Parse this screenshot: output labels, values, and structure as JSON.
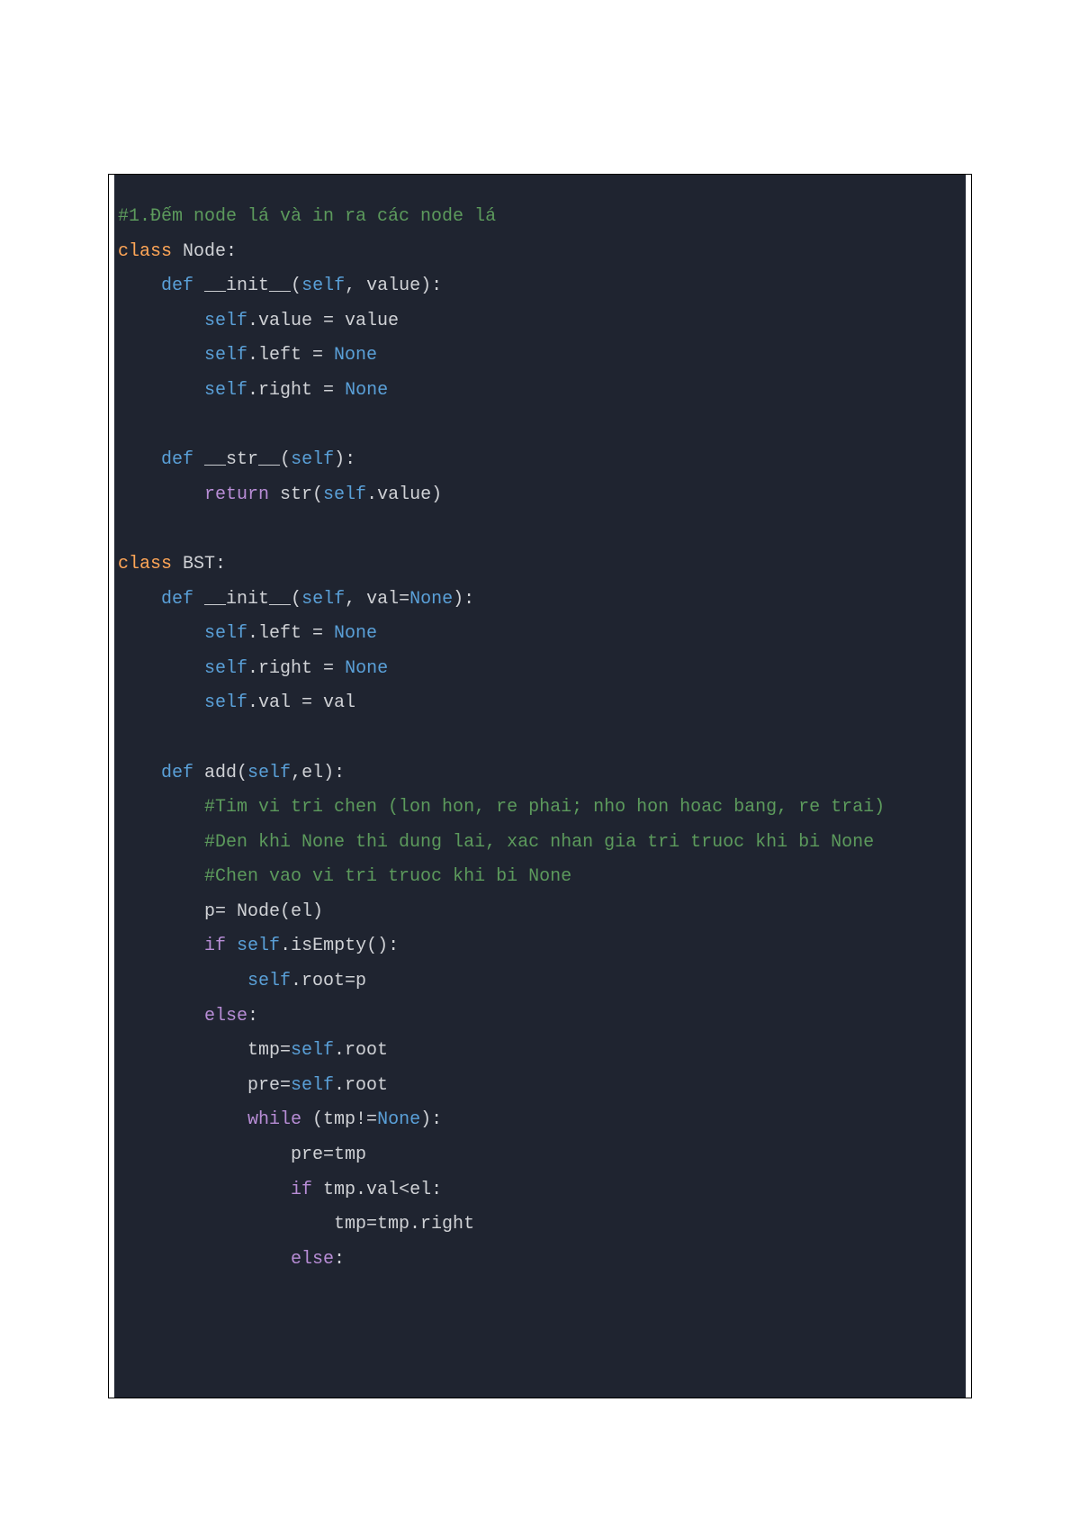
{
  "code": {
    "lines": [
      [
        {
          "t": "#1.Đếm node lá và in ra các node lá",
          "c": "c-comment"
        }
      ],
      [
        {
          "t": "class",
          "c": "c-keyword"
        },
        {
          "t": " Node:",
          "c": "c-name"
        }
      ],
      [
        {
          "t": "    ",
          "c": "c-name"
        },
        {
          "t": "def",
          "c": "c-def"
        },
        {
          "t": " __init__(",
          "c": "c-name"
        },
        {
          "t": "self",
          "c": "c-self"
        },
        {
          "t": ", value):",
          "c": "c-name"
        }
      ],
      [
        {
          "t": "        ",
          "c": "c-name"
        },
        {
          "t": "self",
          "c": "c-self"
        },
        {
          "t": ".value = value",
          "c": "c-name"
        }
      ],
      [
        {
          "t": "        ",
          "c": "c-name"
        },
        {
          "t": "self",
          "c": "c-self"
        },
        {
          "t": ".left = ",
          "c": "c-name"
        },
        {
          "t": "None",
          "c": "c-none"
        }
      ],
      [
        {
          "t": "        ",
          "c": "c-name"
        },
        {
          "t": "self",
          "c": "c-self"
        },
        {
          "t": ".right = ",
          "c": "c-name"
        },
        {
          "t": "None",
          "c": "c-none"
        }
      ],
      [
        {
          "t": "",
          "c": "c-name"
        }
      ],
      [
        {
          "t": "    ",
          "c": "c-name"
        },
        {
          "t": "def",
          "c": "c-def"
        },
        {
          "t": " __str__(",
          "c": "c-name"
        },
        {
          "t": "self",
          "c": "c-self"
        },
        {
          "t": "):",
          "c": "c-name"
        }
      ],
      [
        {
          "t": "        ",
          "c": "c-name"
        },
        {
          "t": "return",
          "c": "c-return"
        },
        {
          "t": " str(",
          "c": "c-name"
        },
        {
          "t": "self",
          "c": "c-self"
        },
        {
          "t": ".value)",
          "c": "c-name"
        }
      ],
      [
        {
          "t": "",
          "c": "c-name"
        }
      ],
      [
        {
          "t": "class",
          "c": "c-keyword"
        },
        {
          "t": " BST:",
          "c": "c-name"
        }
      ],
      [
        {
          "t": "    ",
          "c": "c-name"
        },
        {
          "t": "def",
          "c": "c-def"
        },
        {
          "t": " __init__(",
          "c": "c-name"
        },
        {
          "t": "self",
          "c": "c-self"
        },
        {
          "t": ", val=",
          "c": "c-name"
        },
        {
          "t": "None",
          "c": "c-none"
        },
        {
          "t": "):",
          "c": "c-name"
        }
      ],
      [
        {
          "t": "        ",
          "c": "c-name"
        },
        {
          "t": "self",
          "c": "c-self"
        },
        {
          "t": ".left = ",
          "c": "c-name"
        },
        {
          "t": "None",
          "c": "c-none"
        }
      ],
      [
        {
          "t": "        ",
          "c": "c-name"
        },
        {
          "t": "self",
          "c": "c-self"
        },
        {
          "t": ".right = ",
          "c": "c-name"
        },
        {
          "t": "None",
          "c": "c-none"
        }
      ],
      [
        {
          "t": "        ",
          "c": "c-name"
        },
        {
          "t": "self",
          "c": "c-self"
        },
        {
          "t": ".val = val",
          "c": "c-name"
        }
      ],
      [
        {
          "t": "",
          "c": "c-name"
        }
      ],
      [
        {
          "t": "    ",
          "c": "c-name"
        },
        {
          "t": "def",
          "c": "c-def"
        },
        {
          "t": " add(",
          "c": "c-name"
        },
        {
          "t": "self",
          "c": "c-self"
        },
        {
          "t": ",el):",
          "c": "c-name"
        }
      ],
      [
        {
          "t": "        ",
          "c": "c-name"
        },
        {
          "t": "#Tim vi tri chen (lon hon, re phai; nho hon hoac bang, re trai)",
          "c": "c-comment"
        }
      ],
      [
        {
          "t": "        ",
          "c": "c-name"
        },
        {
          "t": "#Den khi None thi dung lai, xac nhan gia tri truoc khi bi None",
          "c": "c-comment"
        }
      ],
      [
        {
          "t": "        ",
          "c": "c-name"
        },
        {
          "t": "#Chen vao vi tri truoc khi bi None",
          "c": "c-comment"
        }
      ],
      [
        {
          "t": "        p= Node(el)",
          "c": "c-name"
        }
      ],
      [
        {
          "t": "        ",
          "c": "c-name"
        },
        {
          "t": "if",
          "c": "c-return"
        },
        {
          "t": " ",
          "c": "c-name"
        },
        {
          "t": "self",
          "c": "c-self"
        },
        {
          "t": ".isEmpty():",
          "c": "c-name"
        }
      ],
      [
        {
          "t": "            ",
          "c": "c-name"
        },
        {
          "t": "self",
          "c": "c-self"
        },
        {
          "t": ".root=p",
          "c": "c-name"
        }
      ],
      [
        {
          "t": "        ",
          "c": "c-name"
        },
        {
          "t": "else",
          "c": "c-return"
        },
        {
          "t": ":",
          "c": "c-name"
        }
      ],
      [
        {
          "t": "            tmp=",
          "c": "c-name"
        },
        {
          "t": "self",
          "c": "c-self"
        },
        {
          "t": ".root",
          "c": "c-name"
        }
      ],
      [
        {
          "t": "            pre=",
          "c": "c-name"
        },
        {
          "t": "self",
          "c": "c-self"
        },
        {
          "t": ".root",
          "c": "c-name"
        }
      ],
      [
        {
          "t": "            ",
          "c": "c-name"
        },
        {
          "t": "while",
          "c": "c-return"
        },
        {
          "t": " (tmp!=",
          "c": "c-name"
        },
        {
          "t": "None",
          "c": "c-none"
        },
        {
          "t": "):",
          "c": "c-name"
        }
      ],
      [
        {
          "t": "                pre=tmp",
          "c": "c-name"
        }
      ],
      [
        {
          "t": "                ",
          "c": "c-name"
        },
        {
          "t": "if",
          "c": "c-return"
        },
        {
          "t": " tmp.val<el:",
          "c": "c-name"
        }
      ],
      [
        {
          "t": "                    tmp=tmp.right",
          "c": "c-name"
        }
      ],
      [
        {
          "t": "                ",
          "c": "c-name"
        },
        {
          "t": "else",
          "c": "c-return"
        },
        {
          "t": ":",
          "c": "c-name"
        }
      ]
    ]
  }
}
